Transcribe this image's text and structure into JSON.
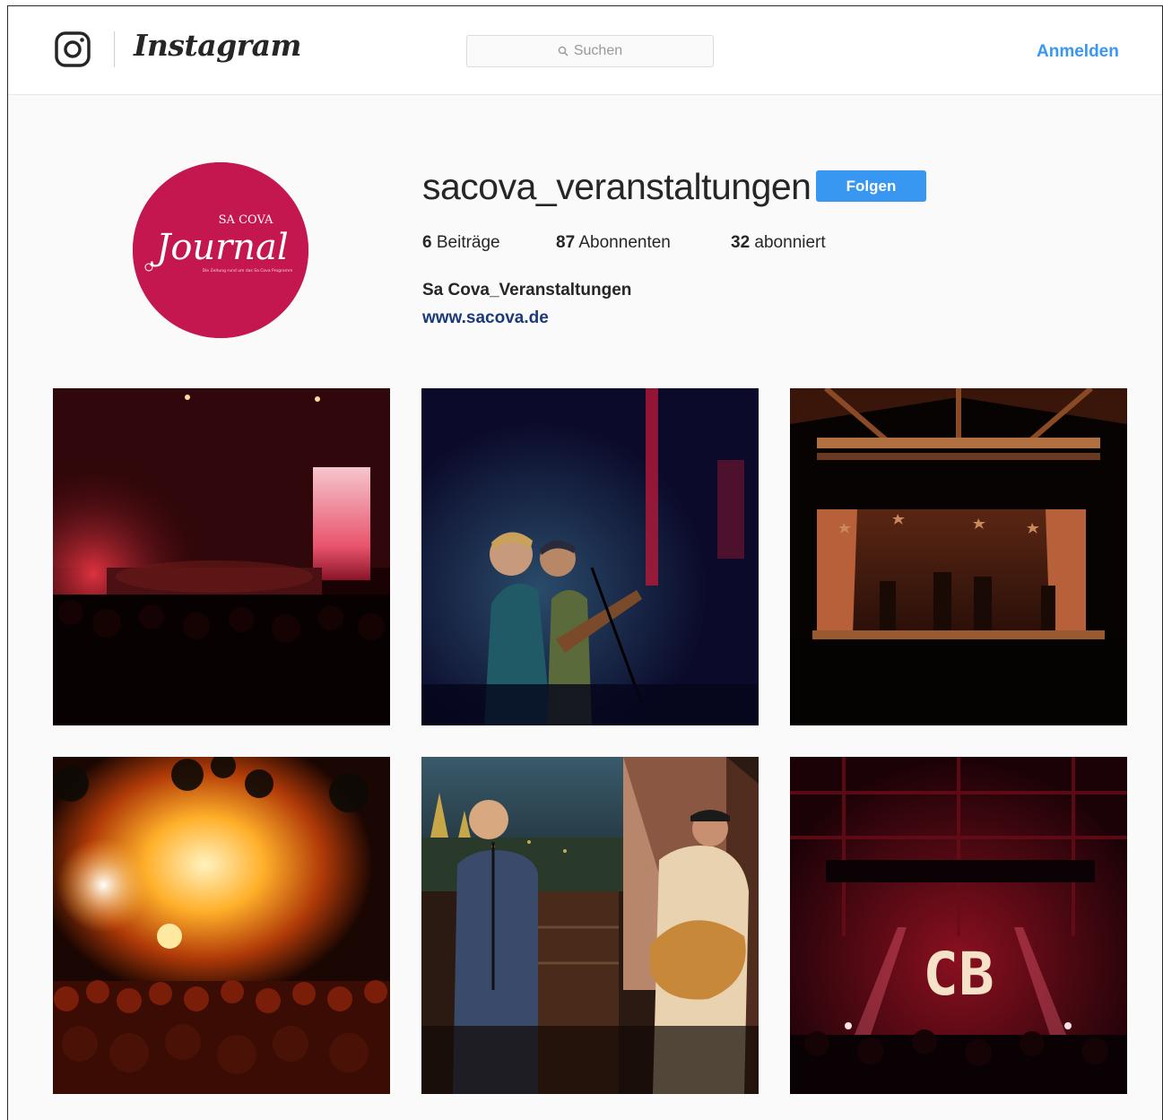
{
  "header": {
    "wordmark": "Instagram",
    "search_placeholder": "Suchen",
    "login_label": "Anmelden"
  },
  "profile": {
    "username": "sacova_veranstaltungen",
    "follow_label": "Folgen",
    "stats": {
      "posts_count": "6",
      "posts_label": "Beiträge",
      "followers_count": "87",
      "followers_label": "Abonnenten",
      "following_count": "32",
      "following_label": "abonniert"
    },
    "full_name": "Sa Cova_Veranstaltungen",
    "website": "www.sacova.de",
    "avatar": {
      "line1": "SA COVA",
      "line2": "Journal",
      "tagline": "Die Zeitung rund um das Sa Cova Programm"
    }
  },
  "posts": [
    {
      "subject": "concert hall stage with red light panel"
    },
    {
      "subject": "two singers with guitar on dark blue stage"
    },
    {
      "subject": "band on stage under wooden roof beams with stars"
    },
    {
      "subject": "open-air concert crowd in fiery light"
    },
    {
      "subject": "duo with guitar in front of a city backdrop"
    },
    {
      "subject": "red-lit stage with CB letters"
    }
  ],
  "post6_sign": "CB",
  "colors": {
    "accent": "#3897f0",
    "avatar_bg": "#c4174f",
    "link": "#1b3a78"
  }
}
